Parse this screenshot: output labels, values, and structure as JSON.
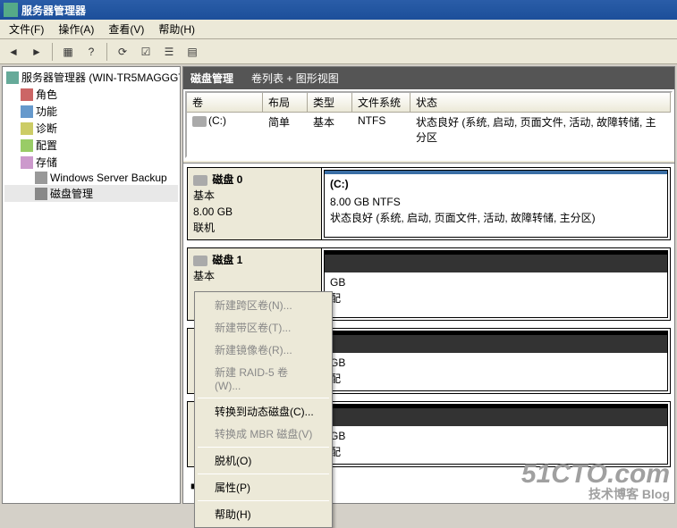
{
  "window": {
    "title": "服务器管理器"
  },
  "menu": {
    "file": "文件(F)",
    "action": "操作(A)",
    "view": "查看(V)",
    "help": "帮助(H)"
  },
  "tree": {
    "root": "服务器管理器 (WIN-TR5MAGGGT1O)",
    "roles": "角色",
    "features": "功能",
    "diag": "诊断",
    "config": "配置",
    "storage": "存储",
    "backup": "Windows Server Backup",
    "diskmgmt": "磁盘管理"
  },
  "header": {
    "title": "磁盘管理",
    "subtitle": "卷列表 + 图形视图"
  },
  "vol_cols": {
    "vol": "卷",
    "layout": "布局",
    "type": "类型",
    "fs": "文件系统",
    "status": "状态"
  },
  "vol_row": {
    "name": "(C:)",
    "layout": "简单",
    "type": "基本",
    "fs": "NTFS",
    "status": "状态良好 (系统, 启动, 页面文件, 活动, 故障转储, 主分区"
  },
  "disk0": {
    "title": "磁盘 0",
    "type": "基本",
    "size": "8.00 GB",
    "state": "联机",
    "p0_name": "(C:)",
    "p0_info": "8.00 GB NTFS",
    "p0_status": "状态良好 (系统, 启动, 页面文件, 活动, 故障转储, 主分区)"
  },
  "disk1": {
    "title": "磁盘 1",
    "type": "基本",
    "p_size": "GB",
    "p_state": "配"
  },
  "diskX1": {
    "p_size": "GB",
    "p_state": "配"
  },
  "diskX2": {
    "p_size": "GB",
    "p_state": "配",
    "left": "未分配"
  },
  "ctx": {
    "span": "新建跨区卷(N)...",
    "stripe": "新建带区卷(T)...",
    "mirror": "新建镜像卷(R)...",
    "raid5": "新建 RAID-5 卷(W)...",
    "dynamic": "转换到动态磁盘(C)...",
    "mbr": "转换成 MBR 磁盘(V)",
    "offline": "脱机(O)",
    "prop": "属性(P)",
    "help": "帮助(H)"
  },
  "watermark": {
    "big": "51CTO.com",
    "small": "技术博客   Blog"
  }
}
